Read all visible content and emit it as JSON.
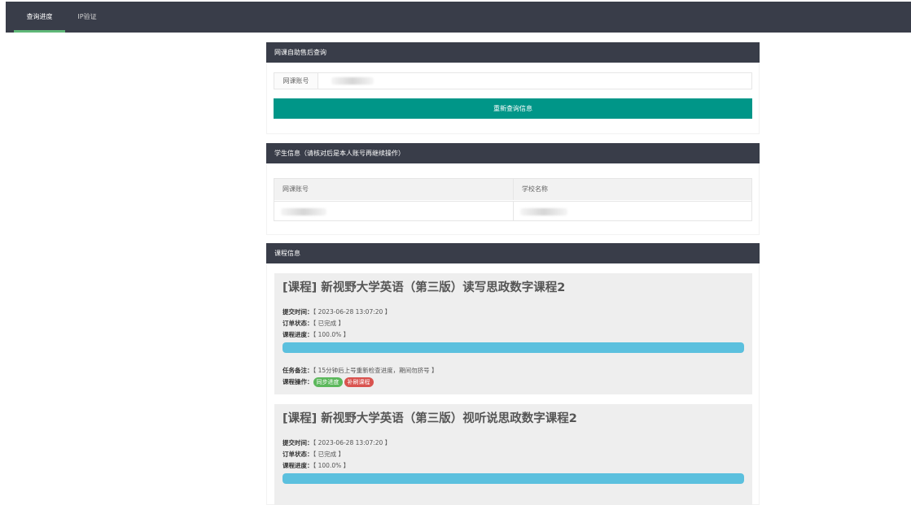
{
  "nav": {
    "tabs": [
      {
        "label": "查询进度",
        "active": true
      },
      {
        "label": "IP验证",
        "active": false
      }
    ]
  },
  "query_panel": {
    "header": "网课自助售后查询",
    "account_label": "网课账号",
    "account_value": "",
    "button_label": "重新查询信息"
  },
  "student_panel": {
    "header": "学生信息（请核对后是本人账号再继续操作）",
    "columns": [
      "网课账号",
      "学校名称"
    ]
  },
  "course_panel": {
    "header": "课程信息",
    "courses": [
      {
        "title": "[课程] 新视野大学英语（第三版）读写思政数字课程2",
        "submit_label": "提交时间：",
        "submit_value": "【 2023-06-28 13:07:20 】",
        "status_label": "订单状态：",
        "status_value": "【 已完成 】",
        "progress_label": "课程进度：",
        "progress_value": "【 100.0% 】",
        "progress": 1.0,
        "note_label": "任务备注：",
        "note_value": "【 15分钟后上号重新检查进度，期间勿挤号 】",
        "ops_label": "课程操作：",
        "ops": [
          "同步进度",
          "补刷课程"
        ]
      },
      {
        "title": "[课程] 新视野大学英语（第三版）视听说思政数字课程2",
        "submit_label": "提交时间：",
        "submit_value": "【 2023-06-28 13:07:20 】",
        "status_label": "订单状态：",
        "status_value": "【 已完成 】",
        "progress_label": "课程进度：",
        "progress_value": "【 100.0% 】",
        "progress": 1.0
      }
    ]
  },
  "colors": {
    "nav_bg": "#393d49",
    "active_tab_underline": "#5fb878",
    "primary_button": "#009688",
    "progress_fill": "#5bc0de",
    "pill_green": "#5cb85c",
    "pill_red": "#d9534f"
  }
}
